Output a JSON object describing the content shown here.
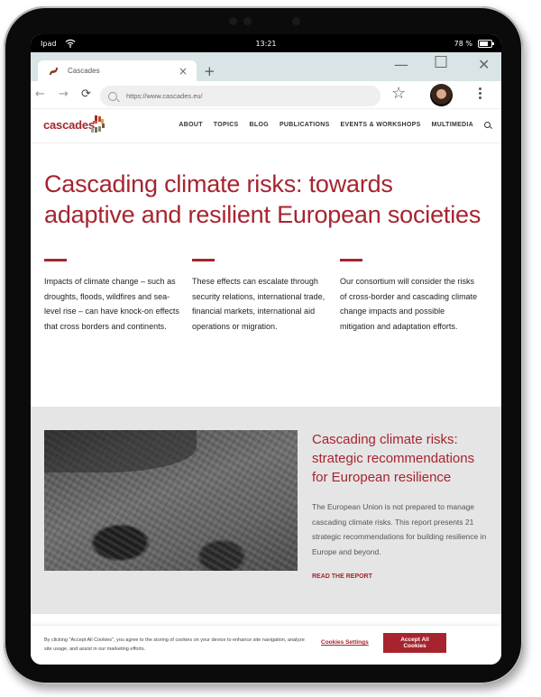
{
  "device": {
    "status_bar": {
      "device_name": "Ipad",
      "time": "13:21",
      "battery_percent": "78 %",
      "battery_level": 0.78
    }
  },
  "browser": {
    "tab": {
      "title": "Cascades",
      "close_icon": "×"
    },
    "new_tab_icon": "+",
    "window_controls": {
      "minimize": "—",
      "maximize": "☐",
      "close": "✕"
    },
    "nav": {
      "back": "←",
      "forward": "→",
      "reload": "⟳"
    },
    "url": "https://www.cascades.eu/",
    "bookmark_icon": "☆"
  },
  "site": {
    "logo_text": "cascades",
    "nav_items": [
      "ABOUT",
      "TOPICS",
      "BLOG",
      "PUBLICATIONS",
      "EVENTS & WORKSHOPS",
      "MULTIMEDIA"
    ],
    "hero_title": "Cascading climate risks: towards adaptive and resilient European societies",
    "columns": [
      {
        "text": "Impacts of climate change – such as droughts, floods, wildfires and sea-level rise – can have knock-on effects that cross borders and continents."
      },
      {
        "text": "These effects can escalate through security relations, international trade, financial markets, international aid operations or migration."
      },
      {
        "text": "Our consortium will consider the risks of cross-border and cascading climate change impacts and possible mitigation and adaptation efforts."
      }
    ],
    "feature": {
      "title": "Cascading climate risks: strategic recommendations for European resilience",
      "body": "The European Union is not prepared to manage cascading climate risks. This report presents 21 strategic recommendations for building resilience in Europe and beyond.",
      "link": "READ THE REPORT",
      "image_alt": "Aerial photo of flooded settlement"
    },
    "cookie_banner": {
      "text": "By clicking \"Accept All Cookies\", you agree to the storing of cookies on your device to enhance site navigation, analyze site usage, and assist in our marketing efforts.",
      "settings_label": "Cookies Settings",
      "accept_label": "Accept All Cookies"
    }
  },
  "colors": {
    "brand": "#a7242f",
    "tab_bar": "#d9e4e6",
    "feature_bg": "#e5e5e5"
  }
}
